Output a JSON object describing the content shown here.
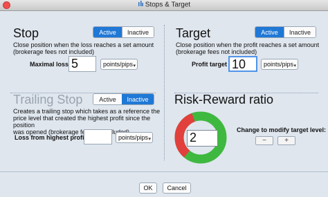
{
  "window": {
    "title": "Stops & Target"
  },
  "colors": {
    "accent": "#1f78d6",
    "risk": "#e2403c",
    "reward": "#3fb83f"
  },
  "stop": {
    "heading": "Stop",
    "active_label": "Active",
    "inactive_label": "Inactive",
    "state": "Active",
    "description_line1": "Close position when the loss reaches a set amount",
    "description_line2": "(brokerage fees not included)",
    "maximal_loss_label": "Maximal loss :",
    "maximal_loss_value": "5",
    "unit": "points/pips"
  },
  "target": {
    "heading": "Target",
    "active_label": "Active",
    "inactive_label": "Inactive",
    "state": "Active",
    "description_line1": "Close position when the profit reaches a set amount",
    "description_line2": "(brokerage fees not included)",
    "profit_target_label": "Profit target :",
    "profit_target_value": "10",
    "unit": "points/pips"
  },
  "trailing_stop": {
    "heading": "Trailing Stop",
    "active_label": "Active",
    "inactive_label": "Inactive",
    "state": "Inactive",
    "description_line1": "Creates a trailing stop which takes as a reference the",
    "description_line2": "price level that created the highest profit since the position",
    "description_line3": "was opened (brokerage fees not included)",
    "loss_label": "Loss from highest profit :",
    "loss_value": "",
    "unit": "points/pips"
  },
  "risk_reward": {
    "heading": "Risk-Reward ratio",
    "ratio_value": "2",
    "risk_share": 0.3333,
    "reward_share": 0.6667,
    "change_label": "Change to modify target level:",
    "minus_label": "−",
    "plus_label": "+"
  },
  "footer": {
    "ok_label": "OK",
    "cancel_label": "Cancel"
  }
}
